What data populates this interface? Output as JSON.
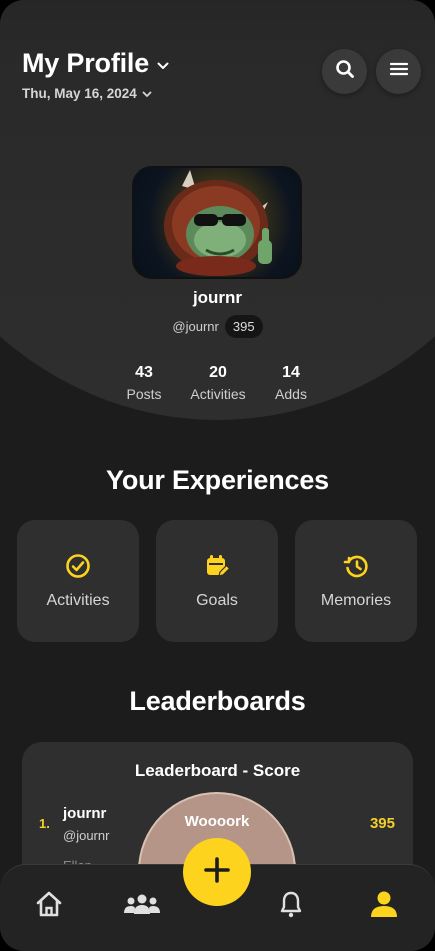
{
  "header": {
    "title": "My Profile",
    "date": "Thu, May 16, 2024"
  },
  "profile": {
    "username": "journr",
    "handle": "@journr",
    "score": "395",
    "stats": [
      {
        "value": "43",
        "label": "Posts"
      },
      {
        "value": "20",
        "label": "Activities"
      },
      {
        "value": "14",
        "label": "Adds"
      }
    ]
  },
  "experiences": {
    "title": "Your Experiences",
    "cards": [
      {
        "label": "Activities",
        "icon": "check-circle-icon"
      },
      {
        "label": "Goals",
        "icon": "calendar-edit-icon"
      },
      {
        "label": "Memories",
        "icon": "history-icon"
      }
    ]
  },
  "leaderboards": {
    "title": "Leaderboards",
    "card_title": "Leaderboard - Score",
    "rows": [
      {
        "rank": "1.",
        "name": "journr",
        "handle": "@journr",
        "score": "395"
      }
    ],
    "next_partial": "Ellan"
  },
  "popup": {
    "text": "Woooork"
  },
  "nav": {
    "items": [
      "home-icon",
      "friends-icon",
      "bell-icon",
      "profile-icon"
    ],
    "fab": "plus-icon"
  },
  "colors": {
    "accent": "#fdd31d",
    "background": "#1c1c1c",
    "card": "#2f2f2f"
  }
}
